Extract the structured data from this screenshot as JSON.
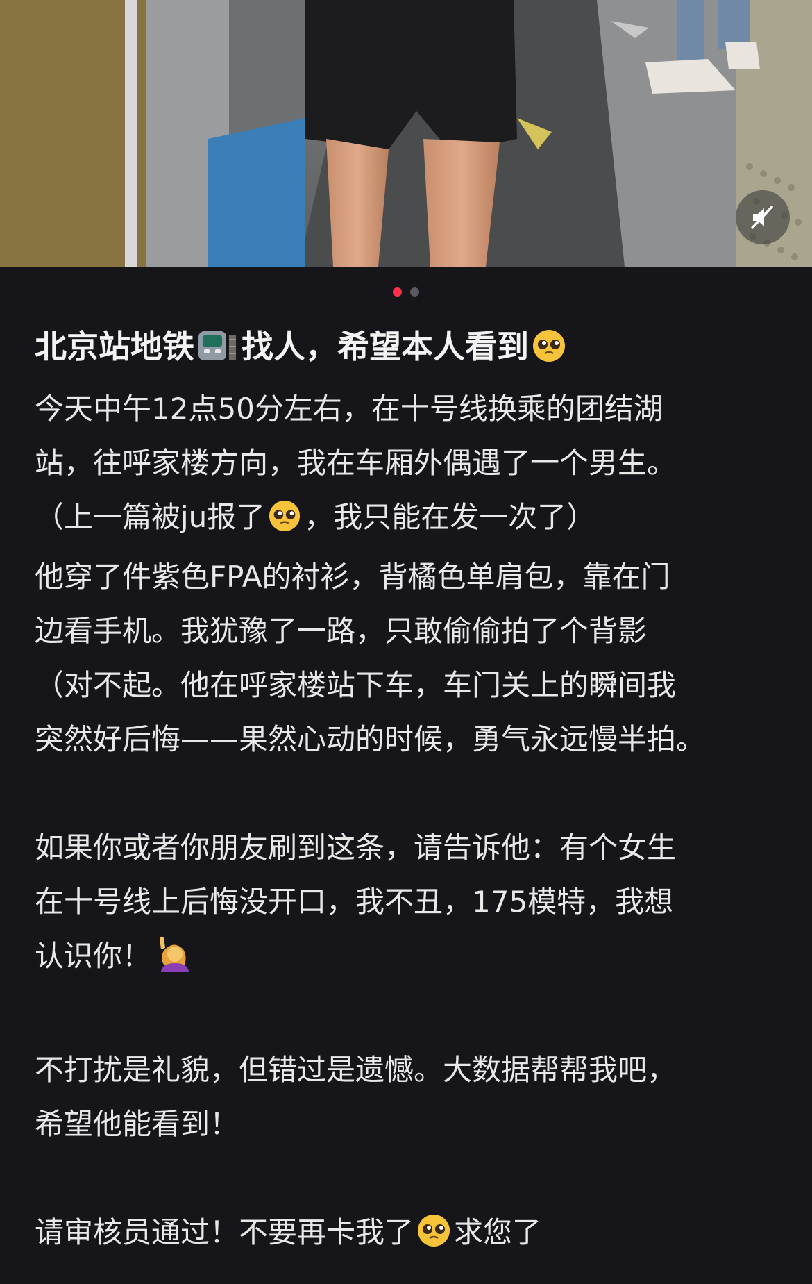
{
  "media": {
    "image_count": 2,
    "active_index": 0,
    "mute_icon": "speaker-muted-icon"
  },
  "post": {
    "title_parts": [
      "北京站地铁",
      "找人，希望本人看到"
    ],
    "title_icons": [
      "metro-train-emoji",
      "pleading-face-emoji"
    ],
    "lines": [
      "今天中午12点50分左右，在十号线换乘的团结湖",
      "站，往呼家楼方向，我在车厢外偶遇了一个男生。",
      [
        "（上一篇被ju报了",
        "，我只能在发一次了）"
      ],
      "他穿了件紫色FPA的衬衫，背橘色单肩包，靠在门",
      "边看手机。我犹豫了一路，只敢偷偷拍了个背影",
      "（对不起。他在呼家楼站下车，车门关上的瞬间我",
      "突然好后悔——果然心动的时候，勇气永远慢半拍。",
      "如果你或者你朋友刷到这条，请告诉他：有个女生",
      "在十号线上后悔没开口，我不丑，175模特，我想",
      "认识你！",
      "不打扰是礼貌，但错过是遗憾。大数据帮帮我吧，",
      "希望他能看到！",
      [
        "请审核员通过！不要再卡我了",
        "求您了"
      ]
    ],
    "emojis": [
      "pleading-face-emoji",
      "person-raising-hand-emoji"
    ]
  }
}
